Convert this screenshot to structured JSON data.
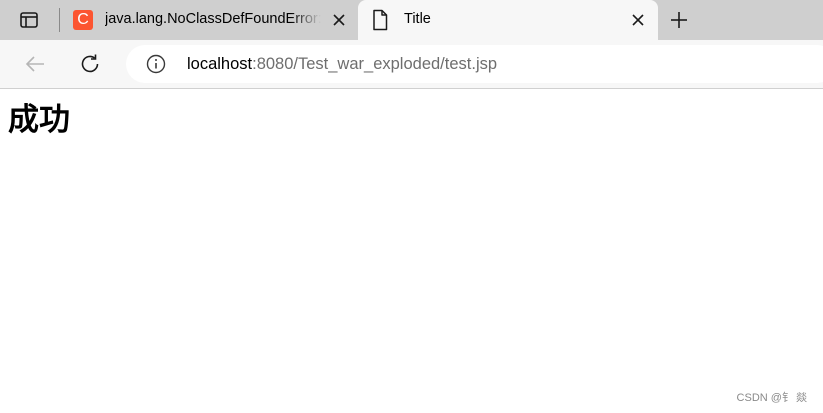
{
  "browser": {
    "tabs": [
      {
        "title": "java.lang.NoClassDefFoundError: com",
        "favicon_letter": "C",
        "favicon_color": "#fc5531",
        "active": false
      },
      {
        "title": "Title",
        "active": true
      }
    ],
    "address": {
      "host": "localhost",
      "rest": ":8080/Test_war_exploded/test.jsp"
    },
    "icons": {
      "tab_actions": "tab-actions-icon",
      "close": "close-icon",
      "new_tab": "plus-icon",
      "back": "back-arrow-icon",
      "reload": "reload-icon",
      "site_info": "info-icon",
      "page": "page-icon"
    }
  },
  "page": {
    "heading": "成功"
  },
  "watermark": "CSDN @钅 燚"
}
